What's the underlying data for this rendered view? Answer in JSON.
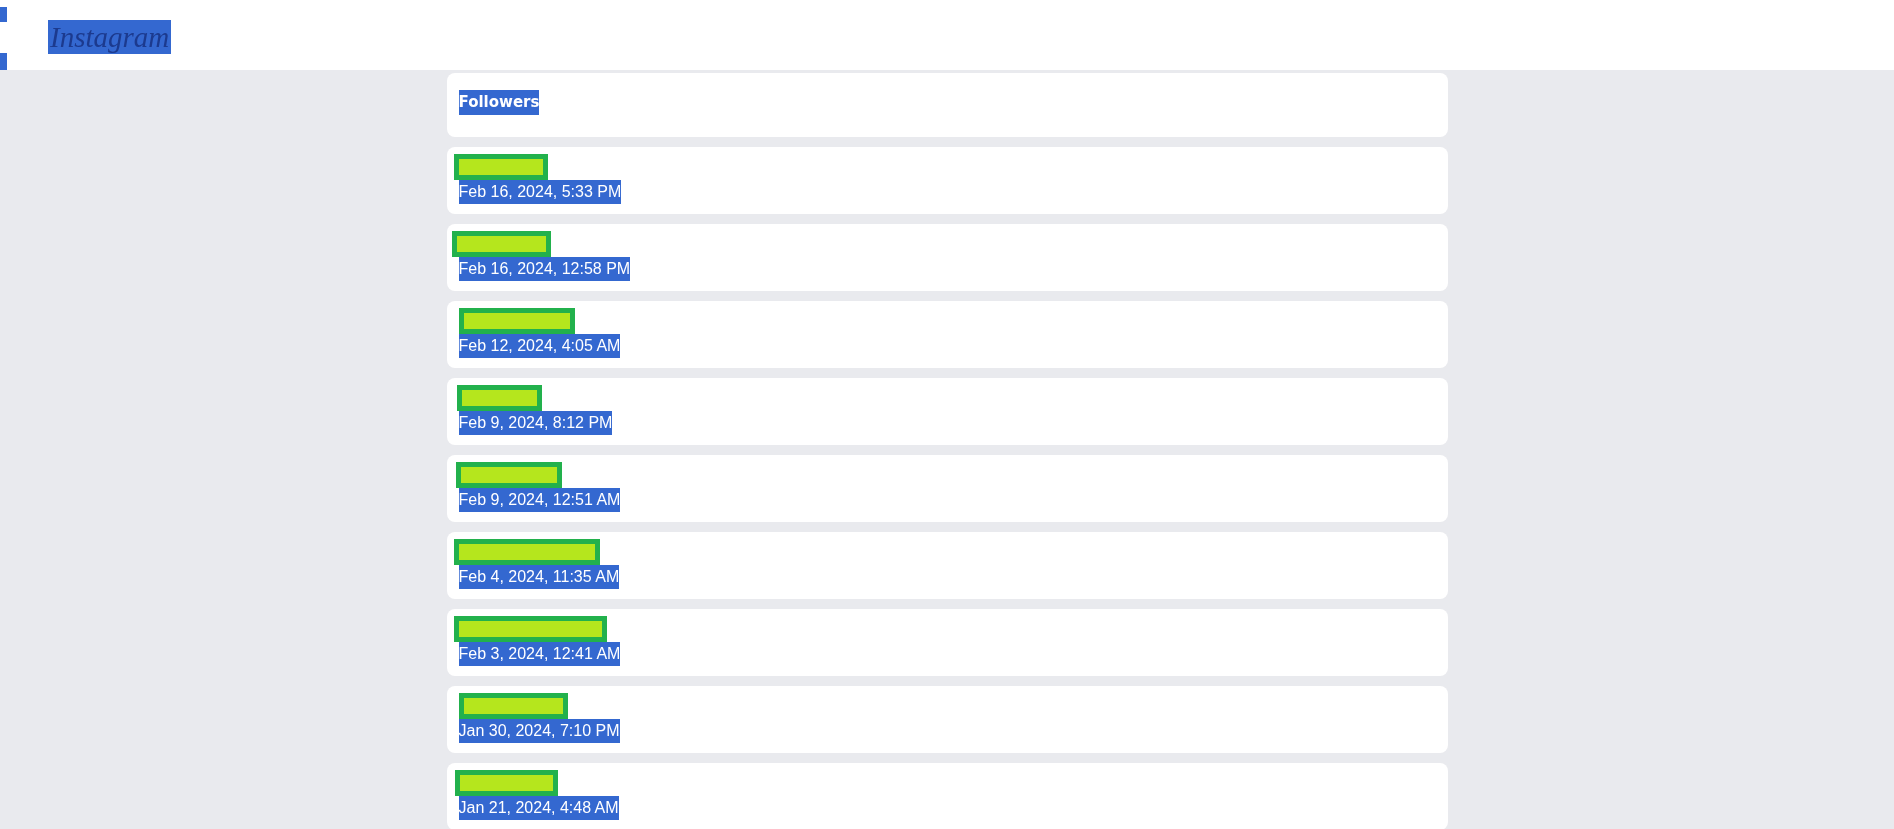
{
  "text_selected": true,
  "header": {
    "logo": "Instagram"
  },
  "section": {
    "title": "Followers"
  },
  "followers": [
    {
      "username_redacted": true,
      "date": "Feb 16, 2024, 5:33 PM"
    },
    {
      "username_redacted": true,
      "date": "Feb 16, 2024, 12:58 PM"
    },
    {
      "username_redacted": true,
      "date": "Feb 12, 2024, 4:05 AM"
    },
    {
      "username_redacted": true,
      "date": "Feb 9, 2024, 8:12 PM"
    },
    {
      "username_redacted": true,
      "date": "Feb 9, 2024, 12:51 AM"
    },
    {
      "username_redacted": true,
      "date": "Feb 4, 2024, 11:35 AM"
    },
    {
      "username_redacted": true,
      "date": "Feb 3, 2024, 12:41 AM"
    },
    {
      "username_redacted": true,
      "date": "Jan 30, 2024, 7:10 PM"
    },
    {
      "username_redacted": true,
      "date": "Jan 21, 2024, 4:48 AM"
    }
  ]
}
